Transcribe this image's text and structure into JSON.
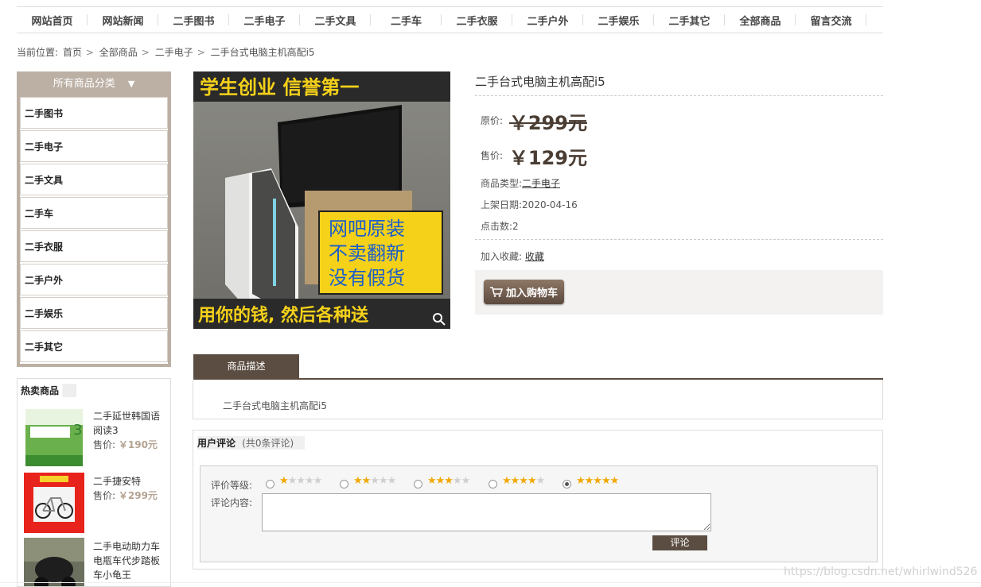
{
  "nav": [
    "网站首页",
    "网站新闻",
    "二手图书",
    "二手电子",
    "二手文具",
    "二手车",
    "二手衣服",
    "二手户外",
    "二手娱乐",
    "二手其它",
    "全部商品",
    "留言交流"
  ],
  "breadcrumb": {
    "prefix": "当前位置:",
    "items": [
      "首页",
      "全部商品",
      "二手电子",
      "二手台式电脑主机高配i5"
    ]
  },
  "sidebar": {
    "title": "所有商品分类",
    "arrow": "▼",
    "categories": [
      "二手图书",
      "二手电子",
      "二手文具",
      "二手车",
      "二手衣服",
      "二手户外",
      "二手娱乐",
      "二手其它"
    ]
  },
  "hot": {
    "title": "热卖商品",
    "items": [
      {
        "name": "二手延世韩国语阅读3",
        "price_label": "售价:",
        "price": "￥190元"
      },
      {
        "name": "二手捷安特",
        "price_label": "售价:",
        "price": "￥299元"
      },
      {
        "name": "二手电动助力车电瓶车代步踏板车小龟王",
        "price_label": "",
        "price": ""
      }
    ]
  },
  "product": {
    "image_top_text": "学生创业  信誉第一",
    "image_box_text": [
      "网吧原装",
      "不卖翻新",
      "没有假货"
    ],
    "image_bottom_text": "用你的钱, 然后各种送",
    "title": "二手台式电脑主机高配i5",
    "orig_label": "原价:",
    "orig_price": "￥299元",
    "sale_label": "售价:",
    "sale_price": "￥129元",
    "type_label": "商品类型:",
    "type_value": "二手电子",
    "date_label": "上架日期:",
    "date_value": "2020-04-16",
    "clicks_label": "点击数:",
    "clicks_value": "2",
    "fav_label": "加入收藏:",
    "fav_link": "收藏",
    "cart_button": "加入购物车"
  },
  "description": {
    "tab": "商品描述",
    "text": "二手台式电脑主机高配i5"
  },
  "comments": {
    "title": "用户评论",
    "count": "(共0条评论)",
    "rating_label": "评价等级:",
    "ratings": [
      1,
      2,
      3,
      4,
      5
    ],
    "selected_rating": 5,
    "content_label": "评论内容:",
    "submit": "评论"
  },
  "watermark": "https://blog.csdn.net/whirlwind526",
  "colors": {
    "accent": "#5c4d42",
    "sidebar": "#bcb0a5",
    "star": "#f1a800"
  }
}
